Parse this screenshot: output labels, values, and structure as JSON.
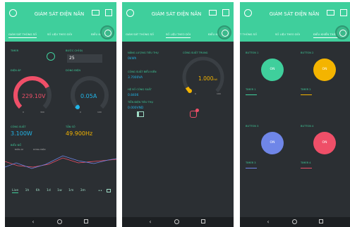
{
  "app_title": "GIÁM SÁT ĐIỆN NĂN",
  "tabs": [
    "GIÁM SÁT THÔNG SỐ",
    "SỐ LIỆU THEO DÕI",
    "ĐIỀU KHIỂN THIẾT BỊ"
  ],
  "tabs_cut": [
    "GIÁM SÁT THÔNG SỐ",
    "SỐ LIỆU THEO DÕI",
    "ĐIỀU KHIỂ",
    "T THÔNG SỐ",
    "SỐ LIỆU THEO DÕI",
    "ĐIỀU KHIỂN THIẾT BỊ"
  ],
  "screen1": {
    "timer_label": "TIMER",
    "step_label": "BƯỚC CHỈ ĐỊ",
    "step_value": "25",
    "voltage_label": "ĐIỆN ÁP",
    "voltage_value": "229.10V",
    "voltage_level": 0.73,
    "current_label": "DÒNG ĐIỆN",
    "current_value": "0.05A",
    "current_level": 0.02,
    "gauge_min": "0",
    "gauge_max_v": "300",
    "gauge_max_a": "100",
    "power_label": "CÔNG SUẤT",
    "power_value": "3.100W",
    "freq_label": "TẦN SỐ",
    "freq_value": "49.900Hz",
    "chart_label": "BIỂU ĐỒ",
    "legend": [
      "ĐIỆN ÁP",
      "DÒNG ĐIỆN"
    ],
    "ranges": [
      "Live",
      "1h",
      "6h",
      "1d",
      "1w",
      "1m",
      "3m"
    ]
  },
  "screen2": {
    "l1": "NĂNG LƯỢNG TIÊU THỤ",
    "v1": "0kWh",
    "l2": "CÔNG SUẤT BIỂU KIẾN",
    "v2": "3.7000VA",
    "l3": "HỆ SỐ CÔNG SUẤT",
    "v3": "0.8406",
    "l4": "TIỀN ĐIỆN TIÊU THỤ",
    "v4": "0.000VND",
    "gauge_label": "CÔNG SUẤT TRUNG",
    "gauge_value": "1.000",
    "gauge_unit": "kW",
    "gauge_level": 0.05,
    "gauge_min": "0",
    "gauge_max": "100"
  },
  "screen3": {
    "buttons": [
      {
        "label": "BUTTON 1",
        "state": "ON",
        "color": "#3fcf9c",
        "timer": "TIMER 1"
      },
      {
        "label": "BUTTON 2",
        "state": "ON",
        "color": "#f4b400",
        "timer": "TIMER 2"
      },
      {
        "label": "BUTTON 3",
        "state": "ON",
        "color": "#6f86e8",
        "timer": "TIMER 3"
      },
      {
        "label": "BUTTON 4",
        "state": "ON",
        "color": "#ef4f68",
        "timer": "TIMER 4"
      }
    ]
  },
  "colors": {
    "accent": "#3fcf9c",
    "voltage": "#ef4f68",
    "current": "#21b5e8",
    "gauge_dot": "#f4b400",
    "power_text": "#21b5e8",
    "freq_text": "#f4b400"
  }
}
